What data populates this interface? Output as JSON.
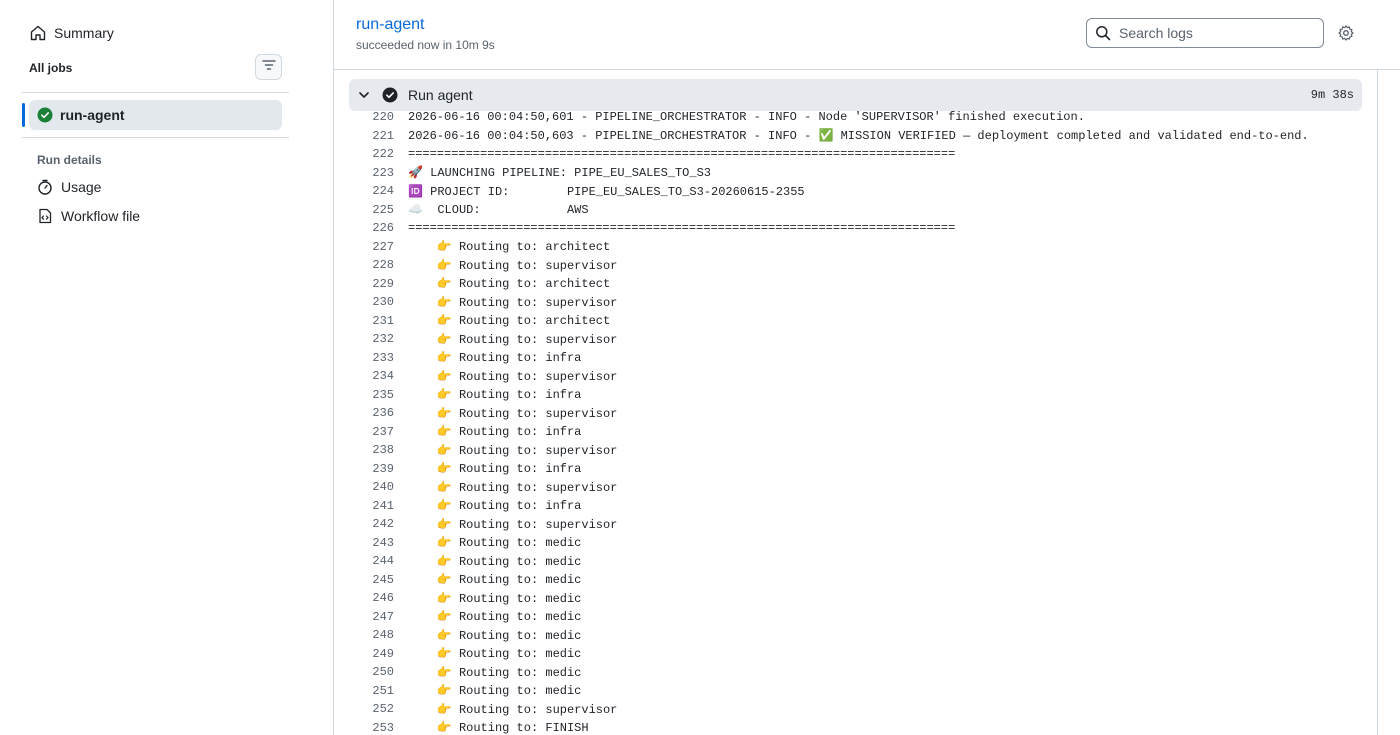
{
  "sidebar": {
    "summary_label": "Summary",
    "all_jobs_label": "All jobs",
    "job_label": "run-agent",
    "run_details_label": "Run details",
    "usage_label": "Usage",
    "workflow_file_label": "Workflow file"
  },
  "header": {
    "title": "run-agent",
    "status": "succeeded now in 10m 9s",
    "search_placeholder": "Search logs"
  },
  "step": {
    "title": "Run agent",
    "duration": "9m 38s"
  },
  "log_lines": [
    {
      "num": "220",
      "text": "2026-06-16 00:04:50,601 - PIPELINE_ORCHESTRATOR - INFO - Node 'SUPERVISOR' finished execution."
    },
    {
      "num": "221",
      "text": "2026-06-16 00:04:50,603 - PIPELINE_ORCHESTRATOR - INFO - ✅ MISSION VERIFIED — deployment completed and validated end-to-end."
    },
    {
      "num": "222",
      "text": "============================================================================"
    },
    {
      "num": "223",
      "text": "🚀 LAUNCHING PIPELINE: PIPE_EU_SALES_TO_S3"
    },
    {
      "num": "224",
      "text": "🆔 PROJECT ID:        PIPE_EU_SALES_TO_S3-20260615-2355"
    },
    {
      "num": "225",
      "text": "☁️  CLOUD:            AWS"
    },
    {
      "num": "226",
      "text": "============================================================================"
    },
    {
      "num": "227",
      "text": "    👉 Routing to: architect"
    },
    {
      "num": "228",
      "text": "    👉 Routing to: supervisor"
    },
    {
      "num": "229",
      "text": "    👉 Routing to: architect"
    },
    {
      "num": "230",
      "text": "    👉 Routing to: supervisor"
    },
    {
      "num": "231",
      "text": "    👉 Routing to: architect"
    },
    {
      "num": "232",
      "text": "    👉 Routing to: supervisor"
    },
    {
      "num": "233",
      "text": "    👉 Routing to: infra"
    },
    {
      "num": "234",
      "text": "    👉 Routing to: supervisor"
    },
    {
      "num": "235",
      "text": "    👉 Routing to: infra"
    },
    {
      "num": "236",
      "text": "    👉 Routing to: supervisor"
    },
    {
      "num": "237",
      "text": "    👉 Routing to: infra"
    },
    {
      "num": "238",
      "text": "    👉 Routing to: supervisor"
    },
    {
      "num": "239",
      "text": "    👉 Routing to: infra"
    },
    {
      "num": "240",
      "text": "    👉 Routing to: supervisor"
    },
    {
      "num": "241",
      "text": "    👉 Routing to: infra"
    },
    {
      "num": "242",
      "text": "    👉 Routing to: supervisor"
    },
    {
      "num": "243",
      "text": "    👉 Routing to: medic"
    },
    {
      "num": "244",
      "text": "    👉 Routing to: medic"
    },
    {
      "num": "245",
      "text": "    👉 Routing to: medic"
    },
    {
      "num": "246",
      "text": "    👉 Routing to: medic"
    },
    {
      "num": "247",
      "text": "    👉 Routing to: medic"
    },
    {
      "num": "248",
      "text": "    👉 Routing to: medic"
    },
    {
      "num": "249",
      "text": "    👉 Routing to: medic"
    },
    {
      "num": "250",
      "text": "    👉 Routing to: medic"
    },
    {
      "num": "251",
      "text": "    👉 Routing to: medic"
    },
    {
      "num": "252",
      "text": "    👉 Routing to: supervisor"
    },
    {
      "num": "253",
      "text": "    👉 Routing to: FINISH"
    }
  ],
  "icons": {
    "summary": "home-icon",
    "filter": "filter-icon",
    "job_status": "check-circle-icon",
    "usage": "stopwatch-icon",
    "workflow": "file-code-icon",
    "search": "search-icon",
    "settings": "gear-icon",
    "collapse": "chevron-down-icon"
  },
  "colors": {
    "success": "#1a7f37",
    "accent": "#0969da",
    "selected_bg": "#e3e8ed"
  }
}
